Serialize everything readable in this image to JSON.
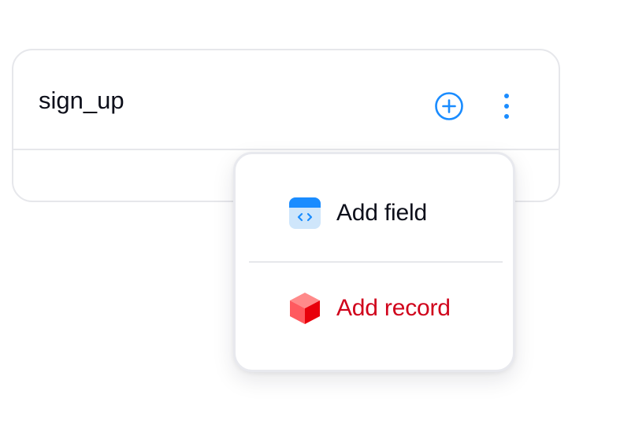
{
  "table": {
    "title": "sign_up"
  },
  "menu": {
    "items": [
      {
        "label": "Add field",
        "icon": "code-field-icon"
      },
      {
        "label": "Add record",
        "icon": "cube-icon",
        "color": "#d0021b"
      }
    ]
  },
  "colors": {
    "accent": "#1a8cff",
    "danger": "#d0021b",
    "text": "#0d0f1a",
    "border": "#e6e7eb"
  }
}
